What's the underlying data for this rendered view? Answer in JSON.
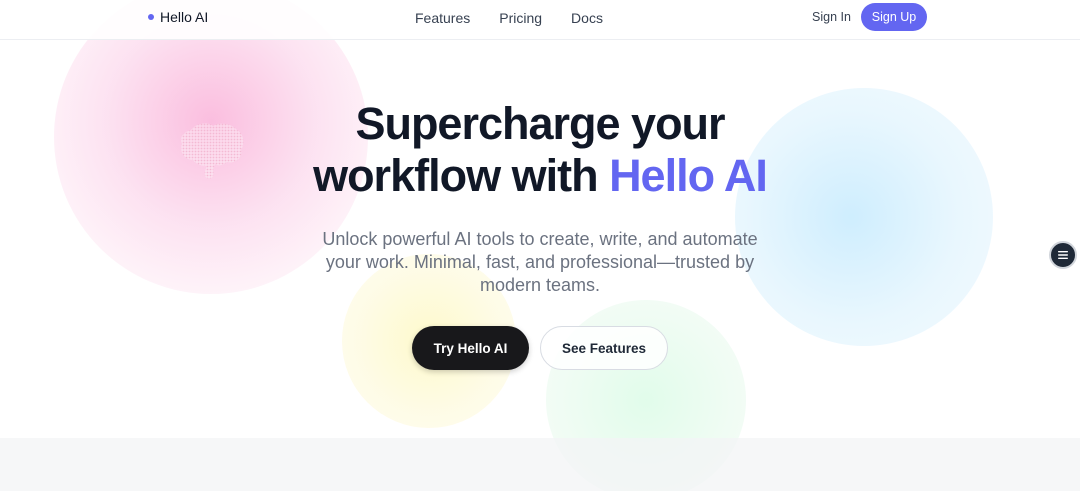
{
  "header": {
    "brand": "Hello AI",
    "nav": [
      "Features",
      "Pricing",
      "Docs"
    ],
    "sign_in": "Sign In",
    "sign_up": "Sign Up"
  },
  "hero": {
    "title_line1": "Supercharge your",
    "title_line2_prefix": "workflow with ",
    "title_accent": "Hello AI",
    "subtitle": "Unlock powerful AI tools to create, write, and automate your work. Minimal, fast, and professional—trusted by modern teams.",
    "primary_button": "Try Hello AI",
    "secondary_button": "See Features"
  },
  "icons": {
    "brand_dot": "dot-icon",
    "floating_menu": "menu-lines-icon",
    "illustration": "brain-icon"
  },
  "colors": {
    "accent": "#6366f1",
    "primary_button": "#18181b",
    "text": "#111827",
    "muted": "#6b7280"
  }
}
